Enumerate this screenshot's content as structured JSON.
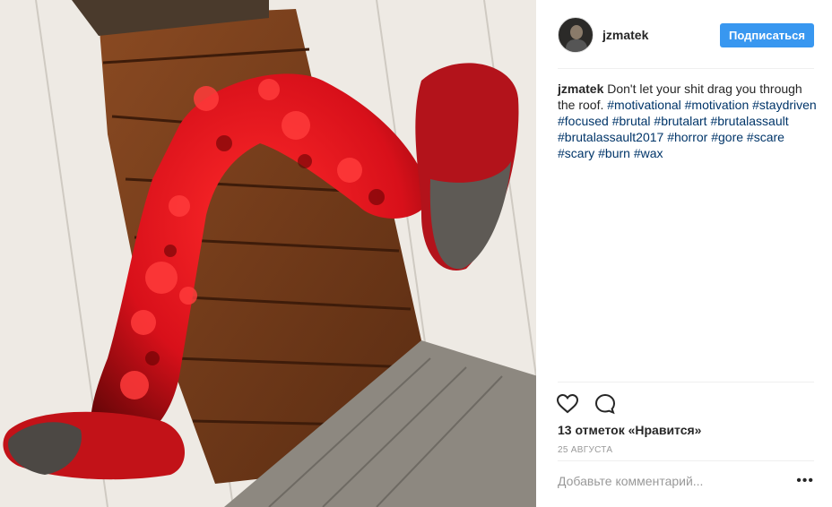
{
  "post": {
    "image_alt": "Red wax-covered mannequin legs bursting through a wooden ceiling",
    "author": {
      "username": "jzmatek",
      "follow_label": "Подписаться"
    },
    "caption": {
      "username": "jzmatek",
      "text": "Don't let your shit drag you through the roof.",
      "hashtags": "#motivational #motivation #staydriven #focused #brutal #brutalart #brutalassault #brutalassault2017 #horror #gore #scare #scary #burn #wax"
    },
    "actions": {
      "like_icon": "heart-icon",
      "comment_icon": "comment-icon"
    },
    "likes_text": "13 отметок «Нравится»",
    "date_text": "25 АВГУСТА",
    "comment": {
      "placeholder": "Добавьте комментарий...",
      "more_icon": "more-options-icon",
      "more_glyph": "•••"
    },
    "colors": {
      "accent": "#3897f0",
      "hashtag": "#003569",
      "muted": "#999999"
    }
  }
}
